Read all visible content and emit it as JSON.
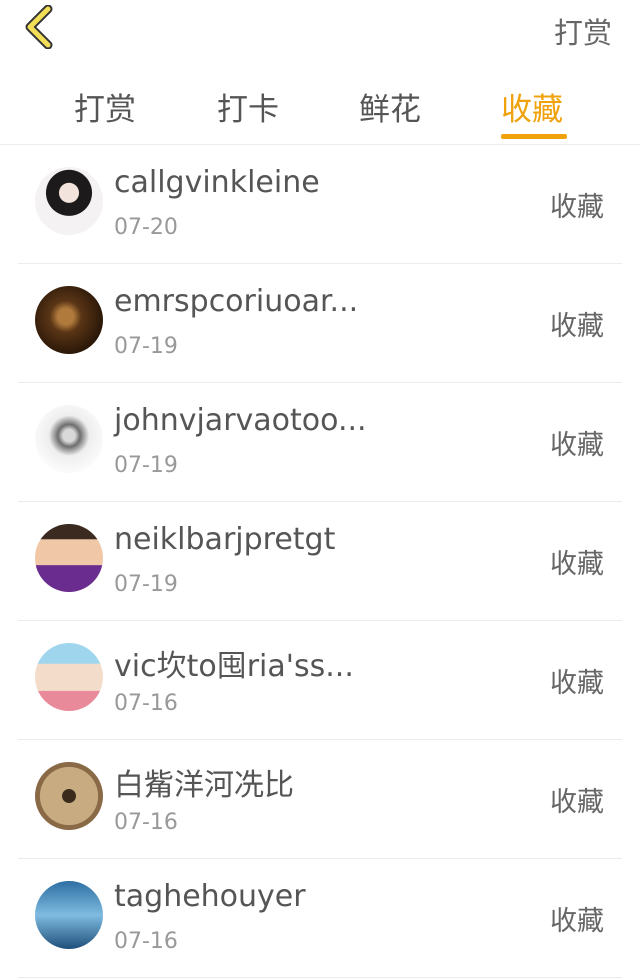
{
  "header": {
    "back_icon": "chevron-left-icon",
    "action_label": "打赏"
  },
  "tabs": [
    {
      "label": "打赏"
    },
    {
      "label": "打卡"
    },
    {
      "label": "鲜花"
    },
    {
      "label": "收藏",
      "active": true
    }
  ],
  "accent_color": "#f0a20c",
  "items": [
    {
      "name": "callgvinkleine",
      "date": "07-20",
      "action": "收藏"
    },
    {
      "name": "emrspcoriuoar...",
      "date": "07-19",
      "action": "收藏"
    },
    {
      "name": "johnvjarvaotoo...",
      "date": "07-19",
      "action": "收藏"
    },
    {
      "name": "neiklbarjpretgt",
      "date": "07-19",
      "action": "收藏"
    },
    {
      "name": "vic坎to囤ria'ss...",
      "date": "07-16",
      "action": "收藏"
    },
    {
      "name": "白觜洋河冼比",
      "date": "07-16",
      "action": "收藏"
    },
    {
      "name": "taghehouyer",
      "date": "07-16",
      "action": "收藏"
    }
  ]
}
